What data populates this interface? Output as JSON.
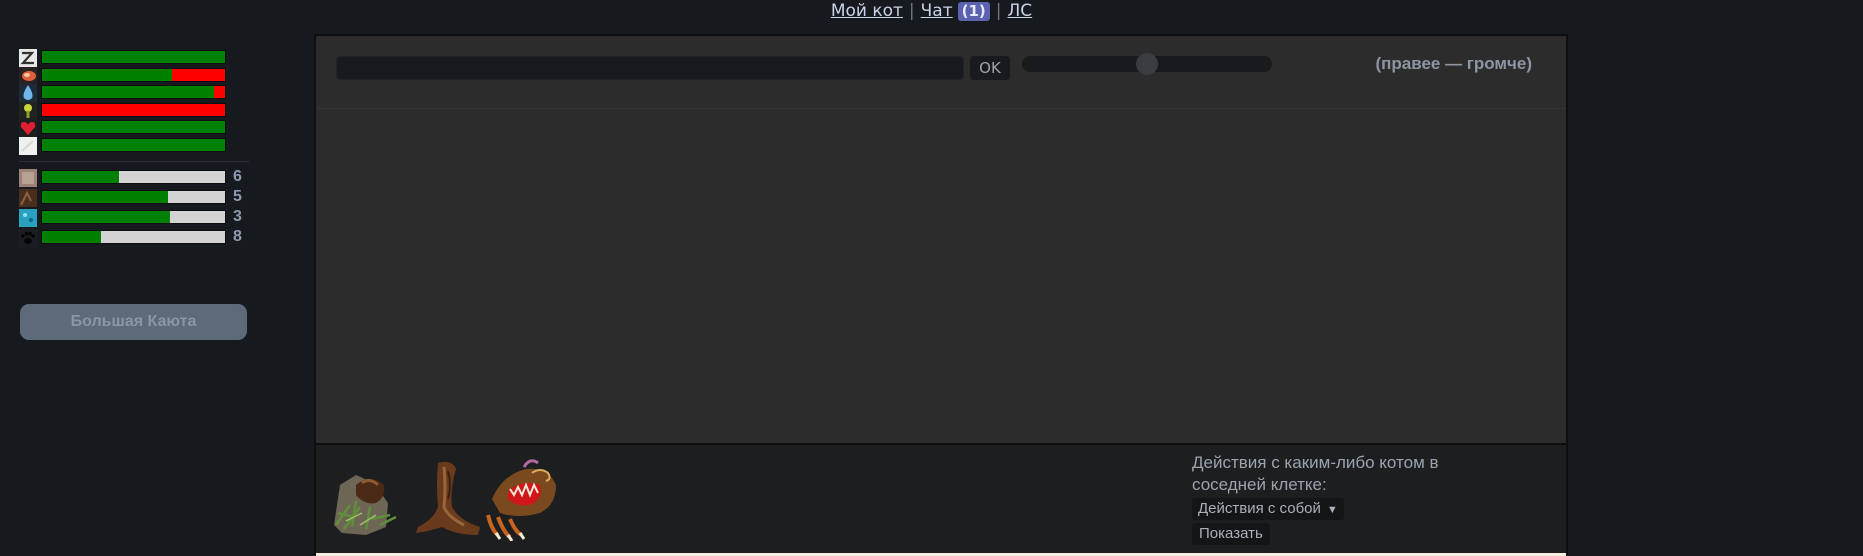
{
  "nav": {
    "my_cat": "Мой кот",
    "chat": "Чат",
    "chat_badge": "(1)",
    "pm": "ЛС",
    "separator": "|"
  },
  "needs": [
    {
      "icon": "sleep-icon",
      "value": 100
    },
    {
      "icon": "food-icon",
      "value": 71
    },
    {
      "icon": "water-icon",
      "value": 94
    },
    {
      "icon": "toilet-icon",
      "value": 0
    },
    {
      "icon": "health-icon",
      "value": 100
    },
    {
      "icon": "cleanliness-icon",
      "value": 100
    }
  ],
  "skills": [
    {
      "icon": "skill-1-icon",
      "value": 42,
      "level": "6"
    },
    {
      "icon": "skill-2-icon",
      "value": 69,
      "level": "5"
    },
    {
      "icon": "skill-3-icon",
      "value": 70,
      "level": "3"
    },
    {
      "icon": "paw-icon",
      "value": 32,
      "level": "8"
    }
  ],
  "location_button": "Большая Каюта",
  "chat": {
    "ok_label": "OK",
    "volume_hint": "(правее — громче)",
    "volume_value": 50
  },
  "items": [
    "grass-moss-item-icon",
    "branch-item-icon",
    "claw-trap-item-icon"
  ],
  "actions": {
    "label": "Действия с каким-либо котом в соседней клетке:",
    "select_value": "Действия с собой",
    "show_button": "Показать"
  },
  "colors": {
    "background": "#16191e",
    "bar_good": "#008000",
    "bar_bad": "#ff0000",
    "bar_empty": "#d3d3d3",
    "badge": "#5b62b0"
  }
}
